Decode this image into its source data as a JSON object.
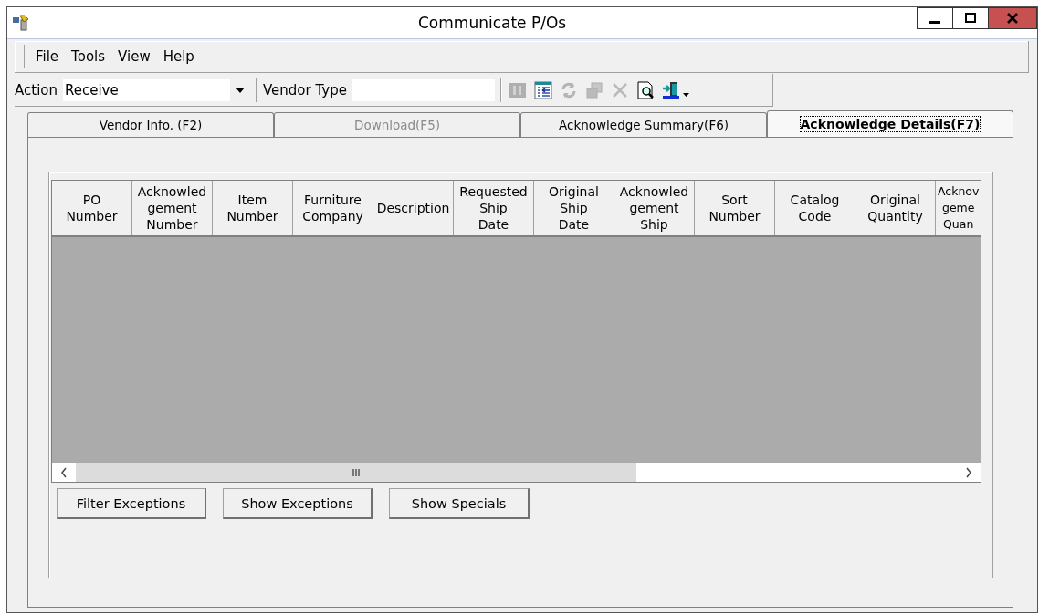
{
  "window": {
    "title": "Communicate P/Os"
  },
  "menu": [
    "File",
    "Tools",
    "View",
    "Help"
  ],
  "toolbar": {
    "action_label": "Action",
    "action_value": "Receive",
    "vendor_type_label": "Vendor Type",
    "tools": [
      {
        "kind": "grid",
        "disabled": true
      },
      {
        "kind": "list",
        "disabled": false
      },
      {
        "kind": "refresh",
        "disabled": true
      },
      {
        "kind": "copy",
        "disabled": true
      },
      {
        "kind": "delete",
        "disabled": true
      },
      {
        "kind": "preview",
        "disabled": false
      },
      {
        "kind": "exit",
        "disabled": false
      }
    ]
  },
  "tabs": [
    {
      "label": "Vendor Info. (F2)",
      "selected": false,
      "disabled": false
    },
    {
      "label": "Download(F5)",
      "selected": false,
      "disabled": true
    },
    {
      "label": "Acknowledge Summary(F6)",
      "selected": false,
      "disabled": false
    },
    {
      "label": "Acknowledge Details(F7)",
      "selected": true,
      "disabled": false
    }
  ],
  "table": {
    "columns": [
      "PO\nNumber",
      "Acknowled\ngement\nNumber",
      "Item\nNumber",
      "Furniture\nCompany",
      "Description",
      "Requested\nShip\nDate",
      "Original\nShip\nDate",
      "Acknowled\ngement\nShip",
      "Sort\nNumber",
      "Catalog\nCode",
      "Original\nQuantity",
      "Acknov\ngeme\nQuan"
    ]
  },
  "buttons": [
    "Filter Exceptions",
    "Show Exceptions",
    "Show Specials"
  ]
}
